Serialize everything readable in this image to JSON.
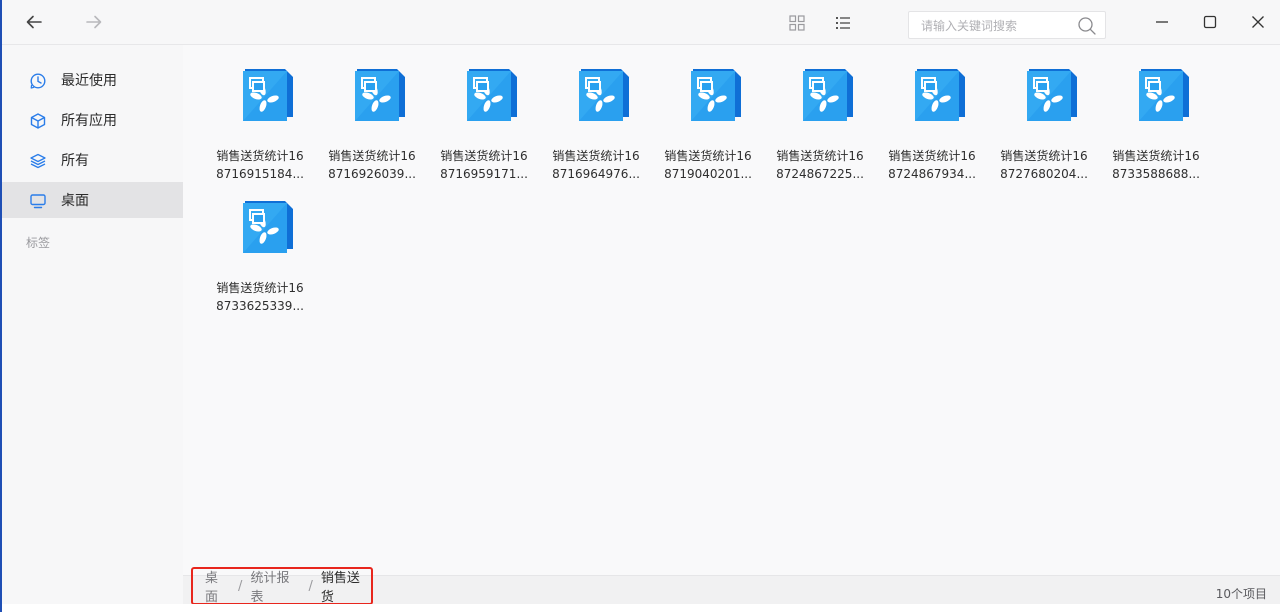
{
  "toolbar": {
    "search_placeholder": "请输入关键词搜索"
  },
  "sidebar": {
    "items": [
      {
        "label": "最近使用",
        "icon": "clock-icon"
      },
      {
        "label": "所有应用",
        "icon": "cube-icon"
      },
      {
        "label": "所有",
        "icon": "layers-icon"
      },
      {
        "label": "桌面",
        "icon": "monitor-icon"
      }
    ],
    "active": "桌面",
    "section_label": "标签"
  },
  "files": [
    {
      "line1": "销售送货统计16",
      "line2": "8716915184..."
    },
    {
      "line1": "销售送货统计16",
      "line2": "8716926039..."
    },
    {
      "line1": "销售送货统计16",
      "line2": "8716959171..."
    },
    {
      "line1": "销售送货统计16",
      "line2": "8716964976..."
    },
    {
      "line1": "销售送货统计16",
      "line2": "8719040201..."
    },
    {
      "line1": "销售送货统计16",
      "line2": "8724867225..."
    },
    {
      "line1": "销售送货统计16",
      "line2": "8724867934..."
    },
    {
      "line1": "销售送货统计16",
      "line2": "8727680204..."
    },
    {
      "line1": "销售送货统计16",
      "line2": "8733588688..."
    },
    {
      "line1": "销售送货统计16",
      "line2": "8733625339..."
    }
  ],
  "breadcrumb": [
    "桌面",
    "统计报表",
    "销售送货"
  ],
  "status": {
    "count": "10个项目"
  },
  "colors": {
    "accent": "#1e88e5",
    "highlight_border": "#e8261d"
  }
}
